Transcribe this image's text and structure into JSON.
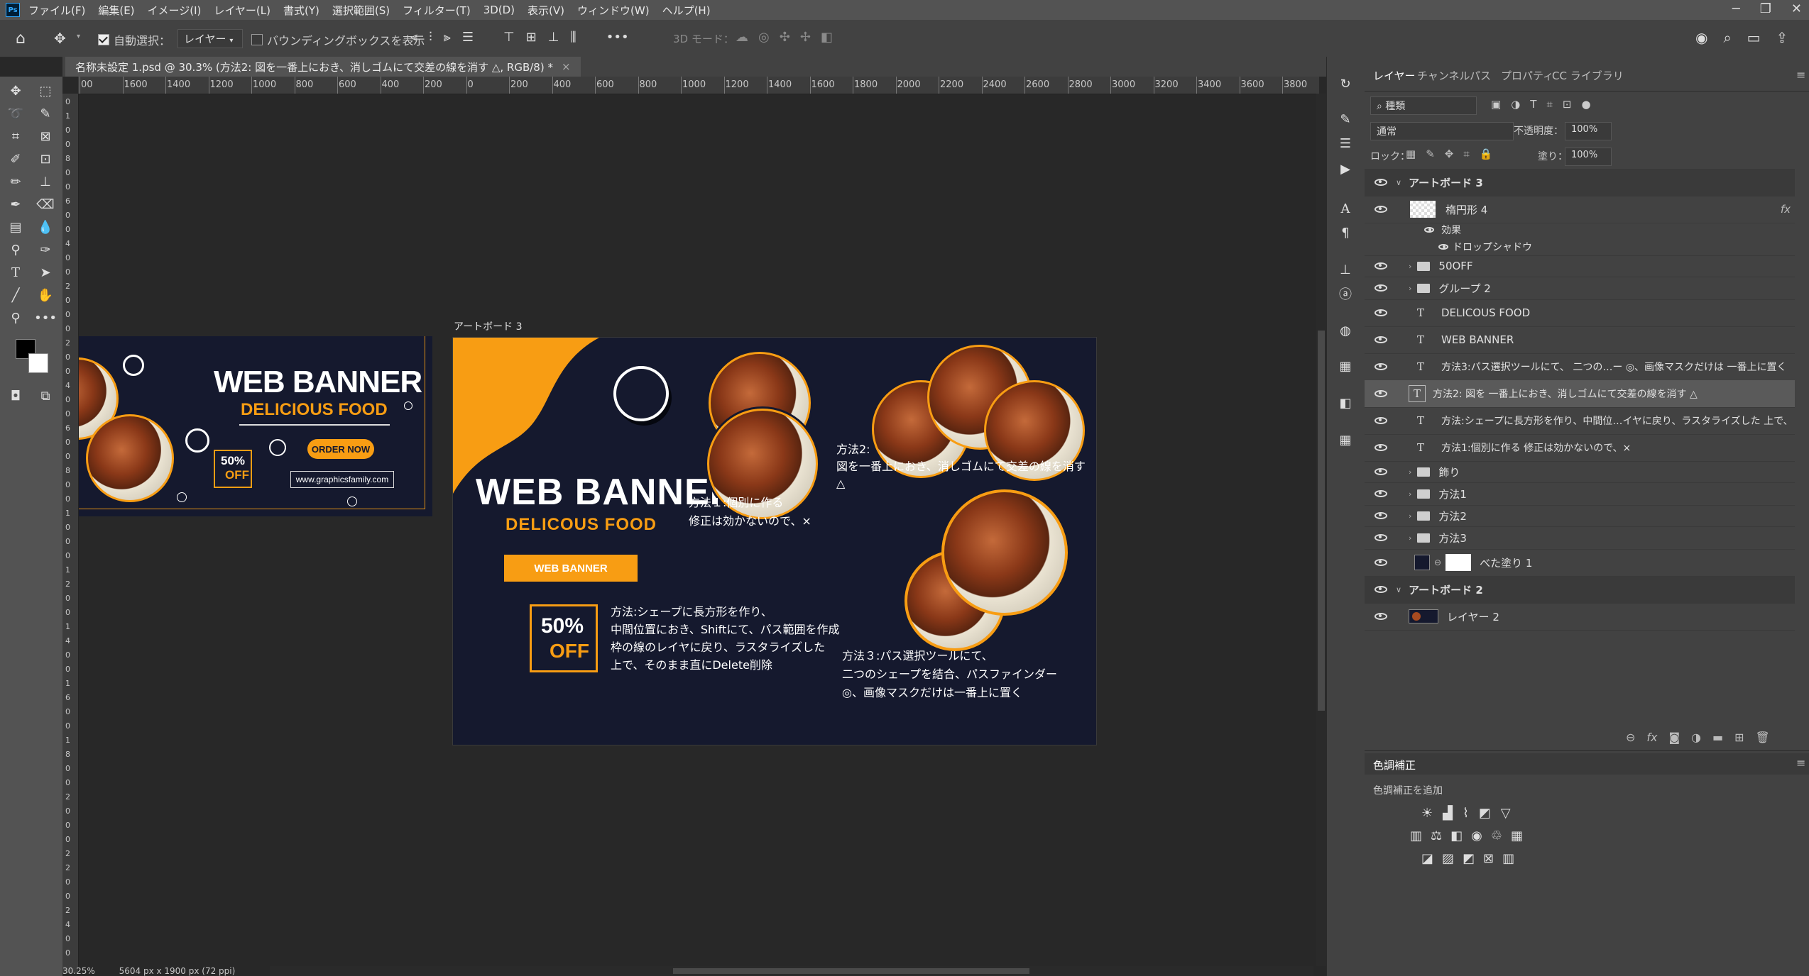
{
  "app": {
    "logo": "Ps"
  },
  "menu": [
    "ファイル(F)",
    "編集(E)",
    "イメージ(I)",
    "レイヤー(L)",
    "書式(Y)",
    "選択範囲(S)",
    "フィルター(T)",
    "3D(D)",
    "表示(V)",
    "ウィンドウ(W)",
    "ヘルプ(H)"
  ],
  "options": {
    "auto_select_label": "自動選択：",
    "auto_select_target": "レイヤー",
    "bounding_box_label": "バウンディングボックスを表示",
    "mode3d_label": "3D モード："
  },
  "document": {
    "tab_title": "名称未設定 1.psd @ 30.3% (方法2: 図を一番上におき、消しゴムにて交差の線を消す △, RGB/8) *",
    "zoom": "30.25%",
    "doc_size": "5604 px x 1900 px (72 ppi)"
  },
  "ruler": {
    "h": [
      "00",
      "1600",
      "1400",
      "1200",
      "1000",
      "800",
      "600",
      "400",
      "200",
      "0",
      "200",
      "400",
      "600",
      "800",
      "1000",
      "1200",
      "1400",
      "1600",
      "1800",
      "2000",
      "2200",
      "2400",
      "2600",
      "2800",
      "3000",
      "3200",
      "3400",
      "3600",
      "3800"
    ],
    "v": [
      "0",
      "1",
      "0",
      "0",
      "8",
      "0",
      "0",
      "6",
      "0",
      "0",
      "4",
      "0",
      "0",
      "2",
      "0",
      "0",
      "0",
      "2",
      "0",
      "0",
      "4",
      "0",
      "0",
      "6",
      "0",
      "0",
      "8",
      "0",
      "0",
      "1",
      "0",
      "0",
      "0",
      "1",
      "2",
      "0",
      "0",
      "1",
      "4",
      "0",
      "0",
      "1",
      "6",
      "0",
      "0",
      "1",
      "8",
      "0",
      "0",
      "2",
      "0",
      "0",
      "0",
      "2",
      "2",
      "0",
      "0",
      "2",
      "4",
      "0",
      "0"
    ]
  },
  "artboard_left": {
    "title": "WEB BANNER",
    "subtitle": "DELICIOUS FOOD",
    "order": "ORDER NOW",
    "pct": "50%",
    "off": "OFF",
    "url": "www.graphicsfamily.com"
  },
  "artboard3": {
    "label": "アートボード 3",
    "title": "WEB BANNER",
    "subtitle": "DELICOUS FOOD",
    "button": "WEB BANNER",
    "pct": "50%",
    "off": "OFF",
    "method1": [
      "方法１:個別に作る",
      "修正は効かないので、×"
    ],
    "method2": [
      "方法2:",
      "図を一番上におき、消しゴムにて交差の線を消す",
      "△"
    ],
    "method_shape": [
      "方法:シェープに長方形を作り、",
      "中間位置におき、Shiftにて、パス範囲を作成",
      "枠の線のレイヤに戻り、ラスタライズした",
      "上で、そのまま直にDelete削除"
    ],
    "method3": [
      "方法３:パス選択ツールにて、",
      "二つのシェープを結合、パスファインダー",
      "◎、画像マスクだけは一番上に置く"
    ]
  },
  "panel": {
    "tabs": [
      "レイヤー",
      "チャンネル",
      "パス",
      "プロパティ",
      "CC ライブラリ"
    ],
    "filter_kind": "種類",
    "blend_mode": "通常",
    "opacity_label": "不透明度：",
    "opacity_value": "100%",
    "lock_label": "ロック：",
    "fill_label": "塗り：",
    "fill_value": "100%",
    "fx": "fx",
    "layers": [
      {
        "name": "アートボード 3",
        "type": "artboard"
      },
      {
        "name": "楕円形 4",
        "type": "shape"
      },
      {
        "name": "効果",
        "type": "effect"
      },
      {
        "name": "ドロップシャドウ",
        "type": "effect2"
      },
      {
        "name": "50OFF",
        "type": "folder"
      },
      {
        "name": "グループ 2",
        "type": "folder"
      },
      {
        "name": "DELICOUS FOOD",
        "type": "text"
      },
      {
        "name": "WEB BANNER",
        "type": "text"
      },
      {
        "name": "方法3:パス選択ツールにて、 二つの…ー ◎、画像マスクだけは 一番上に置く",
        "type": "text"
      },
      {
        "name": "方法2: 図を 一番上におき、消しゴムにて交差の線を消す △",
        "type": "text"
      },
      {
        "name": "方法:シェープに長方形を作り、中間位…イヤに戻り、ラスタライズした 上で、",
        "type": "text"
      },
      {
        "name": "方法1:個別に作る 修正は効かないので、×",
        "type": "text"
      },
      {
        "name": "飾り",
        "type": "folder"
      },
      {
        "name": "方法1",
        "type": "folder"
      },
      {
        "name": "方法2",
        "type": "folder"
      },
      {
        "name": "方法3",
        "type": "folder"
      },
      {
        "name": "べた塗り 1",
        "type": "fill"
      },
      {
        "name": "アートボード 2",
        "type": "artboard"
      },
      {
        "name": "レイヤー 2",
        "type": "image"
      }
    ],
    "adjust_title": "色調補正",
    "adjust_add": "色調補正を追加"
  }
}
